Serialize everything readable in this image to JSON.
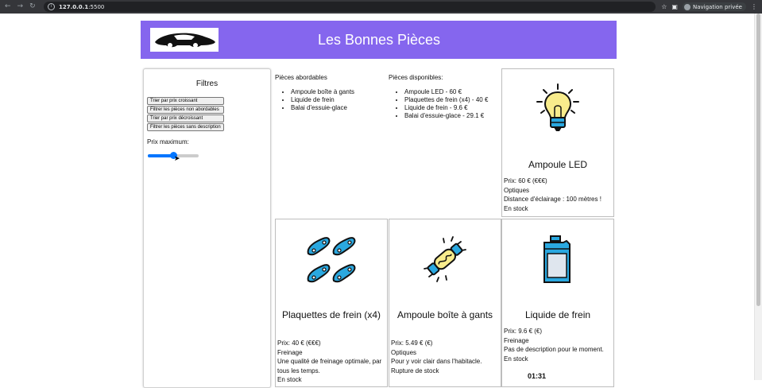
{
  "browser": {
    "url_host": "127.0.0.1",
    "url_port": ":5500",
    "profile": "Navigation privée"
  },
  "header": {
    "title": "Les Bonnes Pièces"
  },
  "filters": {
    "title": "Filtres",
    "buttons": [
      "Trier par prix croissant",
      "Filtrer les pièces non abordables",
      "Trier par prix décroissant",
      "Filtrer les pièces sans description"
    ],
    "price_label": "Prix maximum:",
    "slider_value_fraction": 0.5
  },
  "affordable": {
    "heading": "Pièces abordables",
    "items": [
      "Ampoule boîte à gants",
      "Liquide de frein",
      "Balai d'essuie-glace"
    ]
  },
  "available": {
    "heading": "Pièces disponibles:",
    "items": [
      "Ampoule LED - 60 €",
      "Plaquettes de frein (x4) - 40 €",
      "Liquide de frein - 9.6 €",
      "Balai d'essuie-glace - 29.1 €"
    ]
  },
  "cards": [
    {
      "icon": "lightbulb-icon",
      "name": "Ampoule LED",
      "price": "Prix: 60 € (€€€)",
      "category": "Optiques",
      "description": "Distance d'éclairage : 100 mètres !",
      "stock": "En stock"
    },
    {
      "icon": "brake-pads-icon",
      "name": "Plaquettes de frein (x4)",
      "price": "Prix: 40 € (€€€)",
      "category": "Freinage",
      "description": "Une qualité de freinage optimale, par tous les temps.",
      "stock": "En stock"
    },
    {
      "icon": "glovebox-bulb-icon",
      "name": "Ampoule boîte à gants",
      "price": "Prix: 5.49 € (€)",
      "category": "Optiques",
      "description": "Pour y voir clair dans l'habitacle.",
      "stock": "Rupture de stock"
    },
    {
      "icon": "brake-fluid-icon",
      "name": "Liquide de frein",
      "price": "Prix: 9.6 € (€)",
      "category": "Freinage",
      "description": "Pas de description pour le moment.",
      "stock": "En stock"
    }
  ],
  "timer": "01:31",
  "colors": {
    "banner": "#8566ee",
    "slider": "#0075ff",
    "icon_blue": "#2aa8e0",
    "icon_yellow": "#f8ec8c"
  }
}
